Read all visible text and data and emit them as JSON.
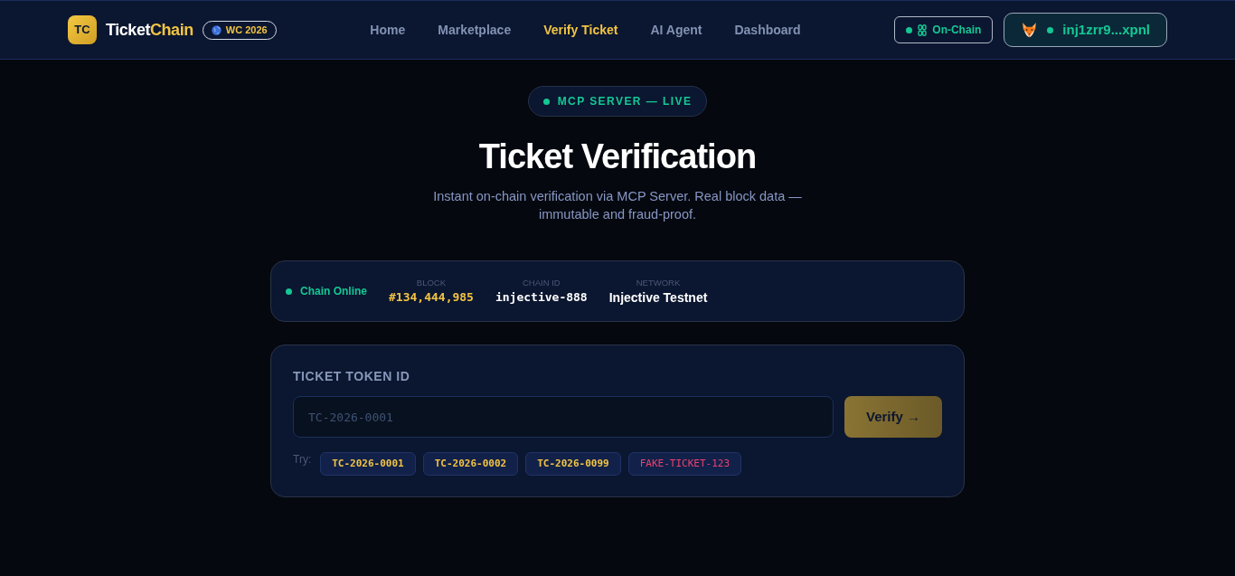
{
  "header": {
    "logo_mark": "TC",
    "brand": {
      "part_1": "Ticket",
      "part_2": "Chain"
    },
    "event_badge": "WC 2026",
    "nav": [
      {
        "label": "Home",
        "selected": false
      },
      {
        "label": "Marketplace",
        "selected": false
      },
      {
        "label": "Verify Ticket",
        "selected": true
      },
      {
        "label": "AI Agent",
        "selected": false
      },
      {
        "label": "Dashboard",
        "selected": false
      }
    ],
    "chain_badge": "On-Chain",
    "wallet": {
      "address": "inj1zrr9...xpnl",
      "connected": true
    }
  },
  "hero": {
    "status_pill": "MCP SERVER — LIVE",
    "title": "Ticket Verification",
    "subtitle": "Instant on-chain verification via MCP Server. Real block data — immutable and fraud-proof."
  },
  "chain_status": {
    "status": "Chain Online",
    "online": true,
    "stats": [
      {
        "label": "BLOCK",
        "value": "#134,444,985",
        "kind": "block"
      },
      {
        "label": "CHAIN ID",
        "value": "injective-888",
        "kind": "id"
      },
      {
        "label": "NETWORK",
        "value": "Injective Testnet",
        "kind": "text"
      }
    ]
  },
  "verify_form": {
    "label": "TICKET TOKEN ID",
    "input": {
      "placeholder": "TC-2026-0001"
    },
    "button": "Verify →",
    "try_label": "Try:",
    "samples": [
      {
        "label": "TC-2026-0001",
        "kind": "valid"
      },
      {
        "label": "TC-2026-0002",
        "kind": "valid"
      },
      {
        "label": "TC-2026-0099",
        "kind": "valid"
      },
      {
        "label": "FAKE-TICKET-123",
        "kind": "invalid"
      }
    ]
  }
}
